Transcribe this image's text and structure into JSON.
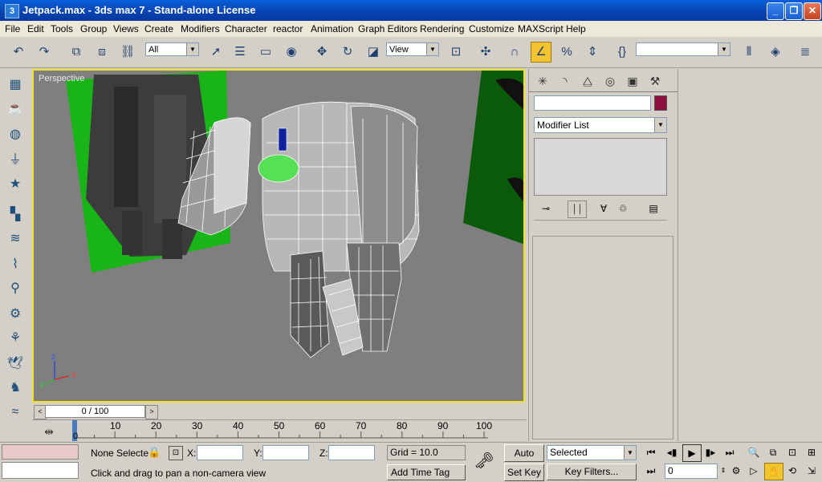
{
  "window": {
    "title": "Jetpack.max - 3ds max 7  - Stand-alone License",
    "minimize": "_",
    "maximize": "❐",
    "close": "✕"
  },
  "menu": [
    "File",
    "Edit",
    "Tools",
    "Group",
    "Views",
    "Create",
    "Modifiers",
    "Character",
    "reactor",
    "Animation",
    "Graph Editors",
    "Rendering",
    "Customize",
    "MAXScript",
    "Help"
  ],
  "toolbar": {
    "selection_filter": "All",
    "reference_coord": "View",
    "named_selection": ""
  },
  "viewport": {
    "label": "Perspective",
    "axis_x": "x",
    "axis_y": "y",
    "axis_z": "z"
  },
  "time_slider": {
    "frame_display": "0 / 100",
    "prev": "<",
    "next": ">",
    "ticks": [
      "0",
      "10",
      "20",
      "30",
      "40",
      "50",
      "60",
      "70",
      "80",
      "90",
      "100"
    ]
  },
  "command_panel": {
    "object_name": "",
    "object_color": "#8a0f3c",
    "modifier_list": "Modifier List"
  },
  "status": {
    "selection": "None Selecte",
    "x_label": "X:",
    "y_label": "Y:",
    "z_label": "Z:",
    "x_value": "",
    "y_value": "",
    "z_value": "",
    "grid": "Grid = 10.0",
    "prompt": "Click and drag to pan a non-camera view",
    "add_time_tag": "Add Time Tag",
    "auto_key": "Auto Key",
    "set_key": "Set Key",
    "key_mode": "Selected",
    "key_filters": "Key Filters...",
    "current_frame": "0"
  },
  "colors": {
    "titlebar": "#0842b0",
    "viewport_border": "#f0e020",
    "viewport_bg": "#7f7f7f",
    "green_plane": "#18b418"
  }
}
